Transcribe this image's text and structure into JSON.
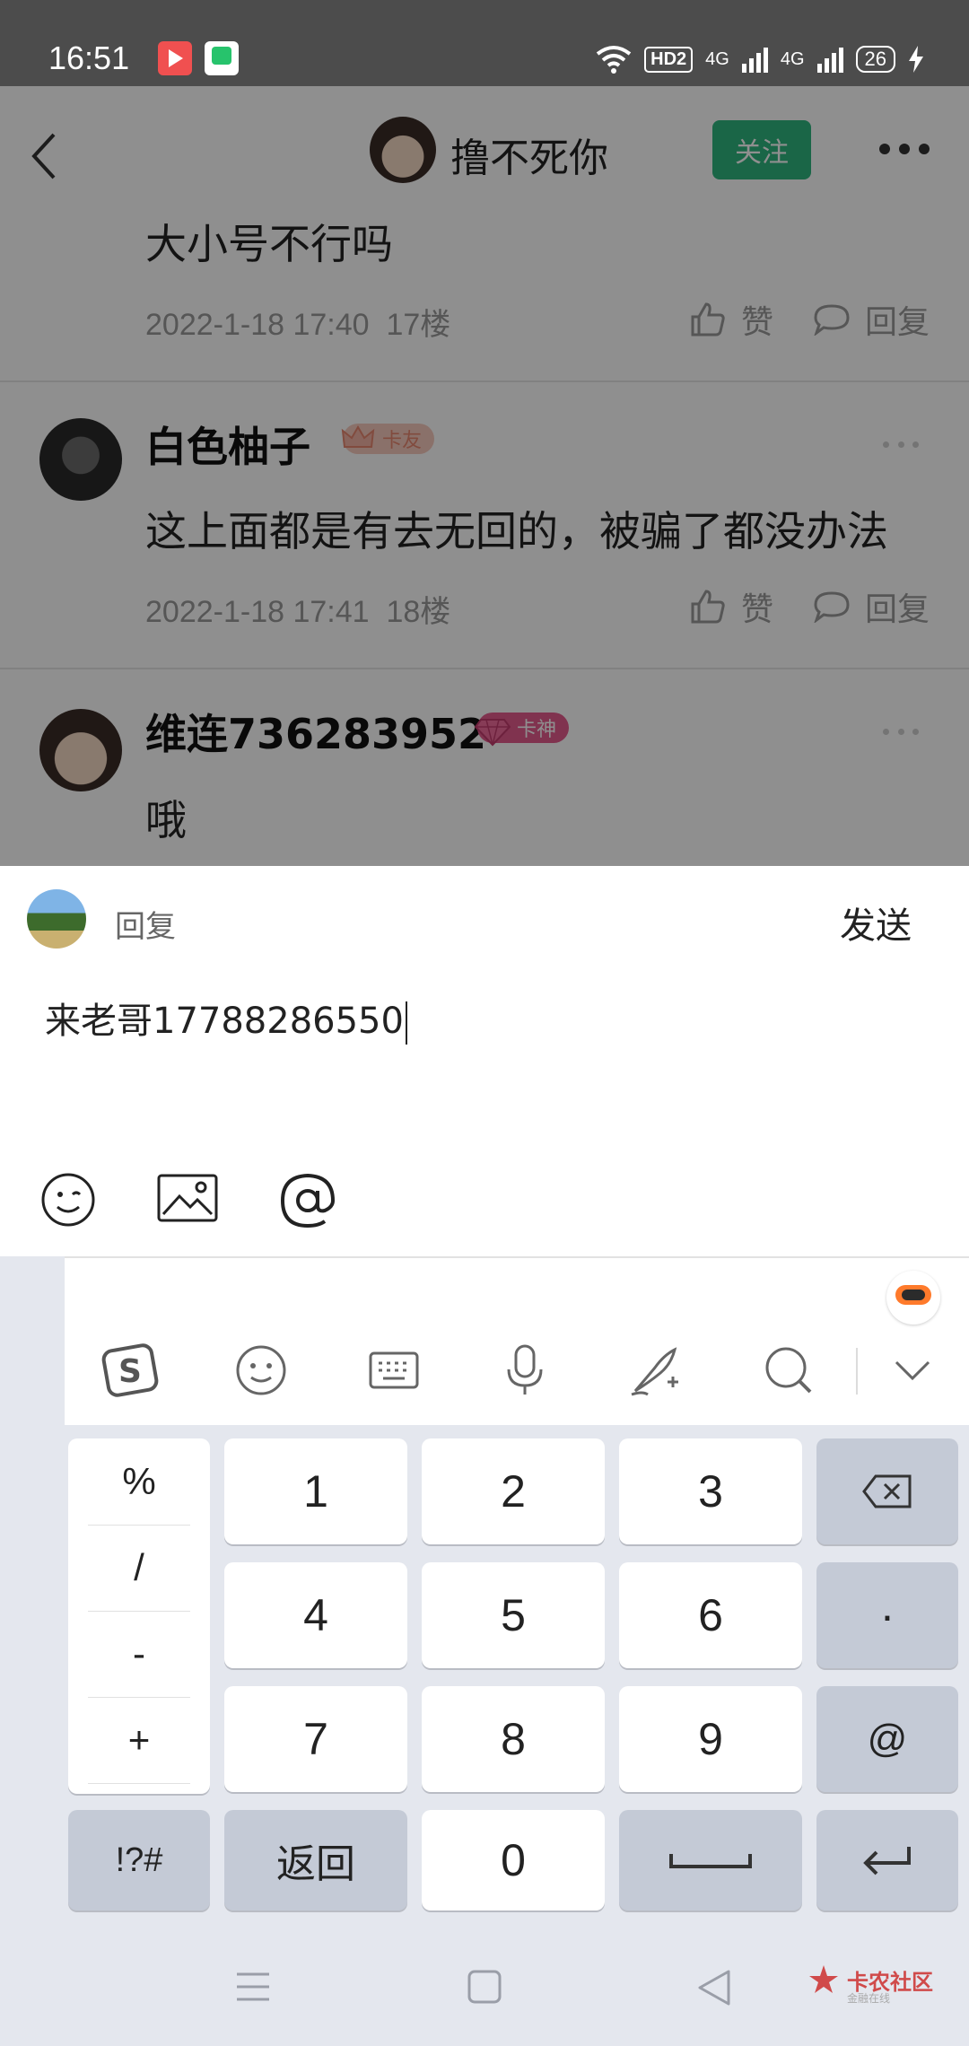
{
  "status_bar": {
    "time": "16:51",
    "hd_badge": "HD2",
    "network_1": "4G",
    "network_2": "4G",
    "battery": "26"
  },
  "header": {
    "title": "撸不死你",
    "follow_label": "关注"
  },
  "comments": [
    {
      "text": "大小号不行吗",
      "date": "2022-1-18 17:40",
      "floor": "17楼",
      "like_label": "赞",
      "reply_label": "回复"
    },
    {
      "name": "白色柚子",
      "badge": "卡友",
      "text": "这上面都是有去无回的，被骗了都没办法",
      "date": "2022-1-18 17:41",
      "floor": "18楼",
      "like_label": "赞",
      "reply_label": "回复"
    },
    {
      "name": "维连736283952",
      "badge": "卡神",
      "text": "哦"
    }
  ],
  "reply": {
    "label": "回复",
    "send_label": "发送",
    "input_value": "来老哥17788286550"
  },
  "keyboard": {
    "symbols": [
      "%",
      "/",
      "-",
      "+"
    ],
    "digits": [
      "1",
      "2",
      "3",
      "4",
      "5",
      "6",
      "7",
      "8",
      "9",
      "0"
    ],
    "dot": "·",
    "at": "@",
    "symbols_key": "!?#",
    "back_key": "返回"
  },
  "watermark": {
    "text": "卡农社区",
    "sub": "金融在线"
  },
  "colors": {
    "follow_green": "#2fb67f",
    "badge_kayou": "#f6c9bd",
    "badge_kashen": "#e45b8e",
    "keyboard_bg": "#e4e7ee",
    "function_key": "#c4cad6"
  }
}
